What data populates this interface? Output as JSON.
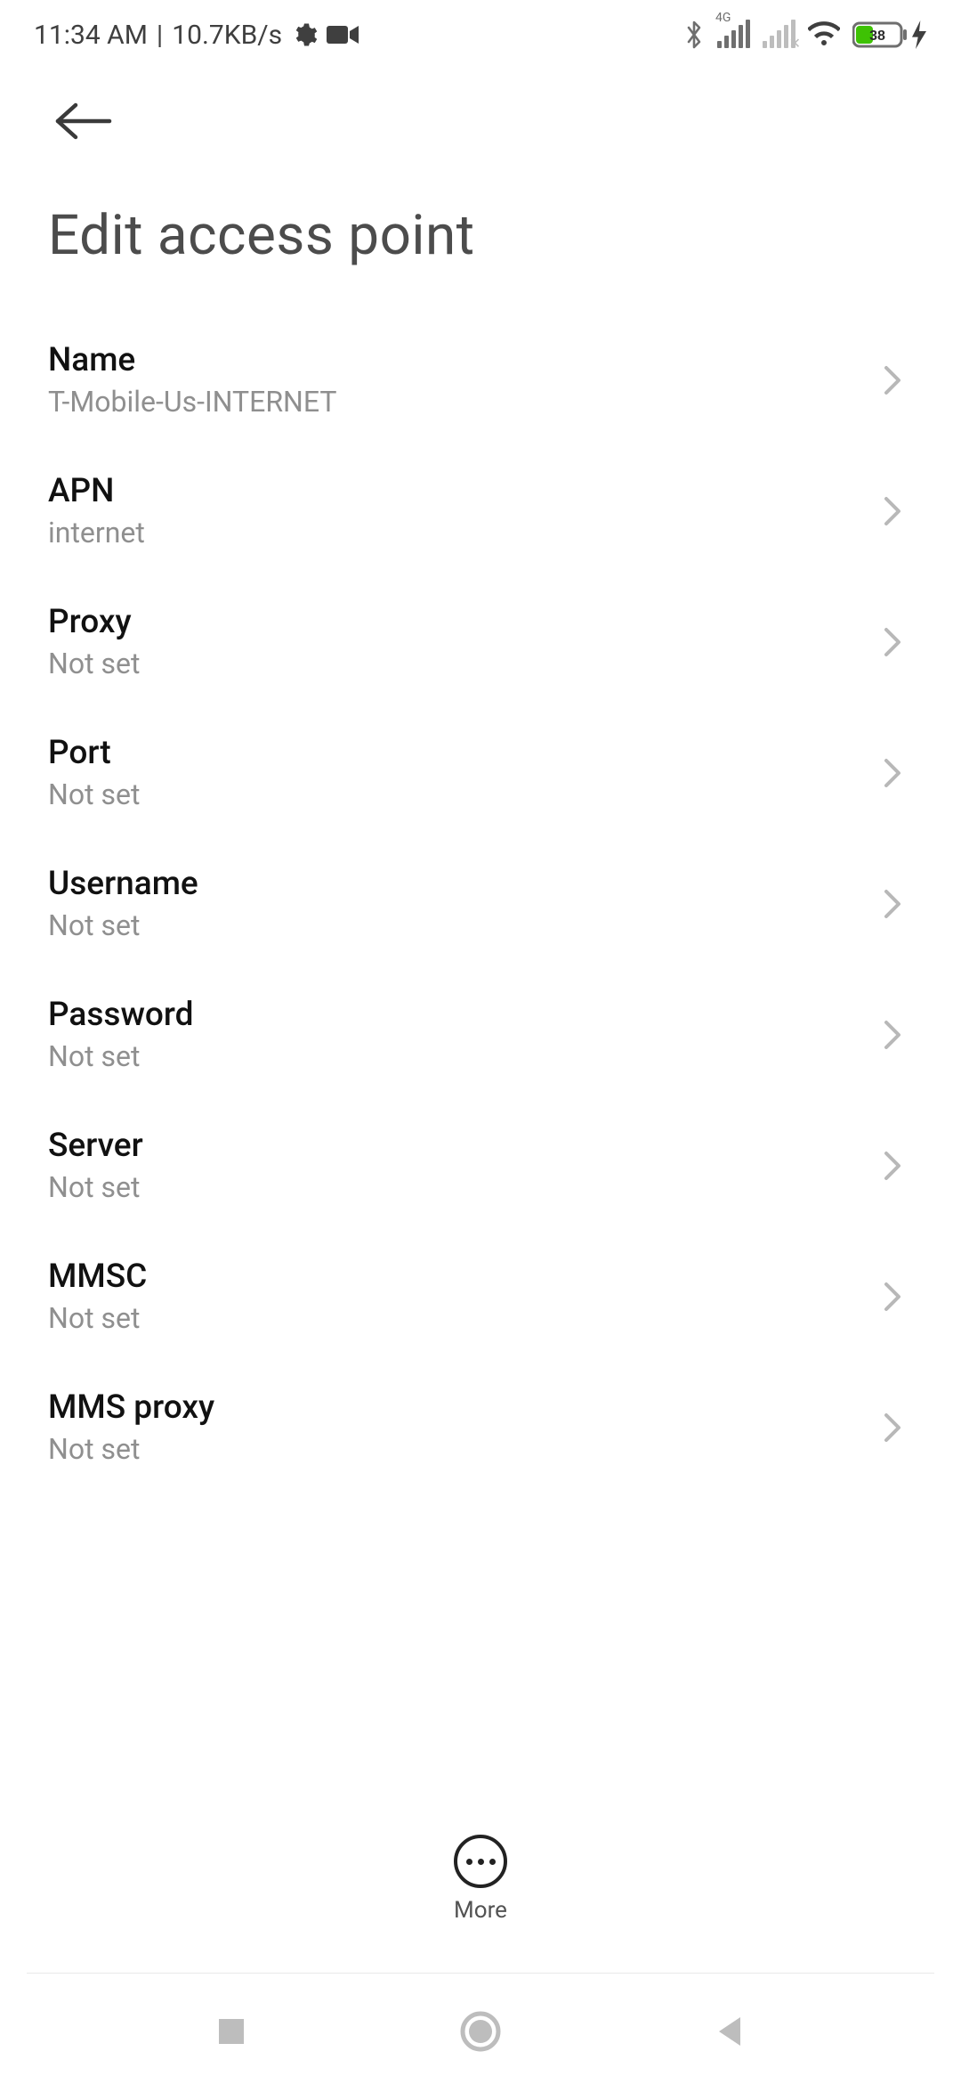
{
  "status": {
    "time": "11:34 AM",
    "separator": "|",
    "speed": "10.7KB/s",
    "network_label_4g": "4G",
    "battery_percent": "38"
  },
  "header": {
    "title": "Edit access point"
  },
  "bottom_action": {
    "more_label": "More"
  },
  "settings": [
    {
      "label": "Name",
      "value": "T-Mobile-Us-INTERNET"
    },
    {
      "label": "APN",
      "value": "internet"
    },
    {
      "label": "Proxy",
      "value": "Not set"
    },
    {
      "label": "Port",
      "value": "Not set"
    },
    {
      "label": "Username",
      "value": "Not set"
    },
    {
      "label": "Password",
      "value": "Not set"
    },
    {
      "label": "Server",
      "value": "Not set"
    },
    {
      "label": "MMSC",
      "value": "Not set"
    },
    {
      "label": "MMS proxy",
      "value": "Not set"
    }
  ]
}
